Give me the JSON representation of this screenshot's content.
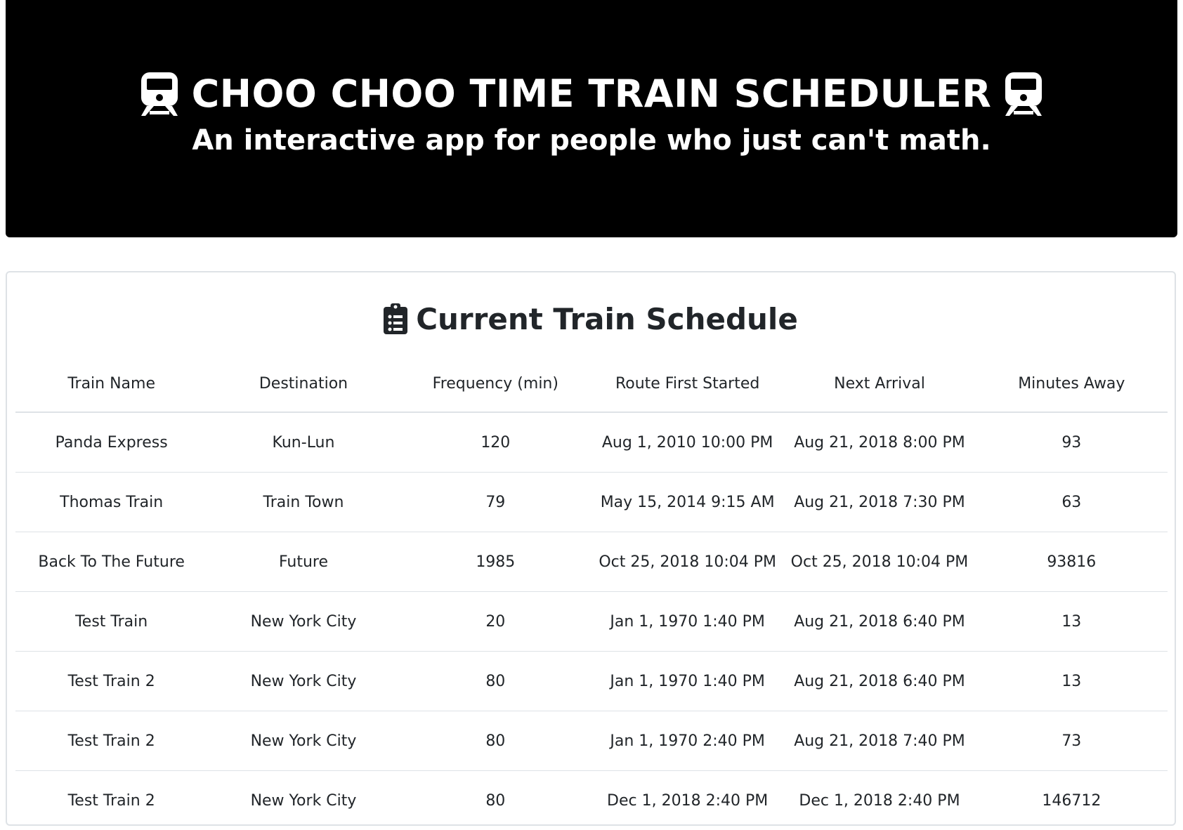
{
  "header": {
    "title": "CHOO CHOO TIME TRAIN SCHEDULER",
    "subtitle": "An interactive app for people who just can't math.",
    "left_icon": "train-icon",
    "right_icon": "train-icon"
  },
  "schedule": {
    "title": "Current Train Schedule",
    "title_icon": "clipboard-list-icon",
    "columns": [
      "Train Name",
      "Destination",
      "Frequency (min)",
      "Route First Started",
      "Next Arrival",
      "Minutes Away"
    ],
    "rows": [
      [
        "Panda Express",
        "Kun-Lun",
        "120",
        "Aug 1, 2010 10:00 PM",
        "Aug 21, 2018 8:00 PM",
        "93"
      ],
      [
        "Thomas Train",
        "Train Town",
        "79",
        "May 15, 2014 9:15 AM",
        "Aug 21, 2018 7:30 PM",
        "63"
      ],
      [
        "Back To The Future",
        "Future",
        "1985",
        "Oct 25, 2018 10:04 PM",
        "Oct 25, 2018 10:04 PM",
        "93816"
      ],
      [
        "Test Train",
        "New York City",
        "20",
        "Jan 1, 1970 1:40 PM",
        "Aug 21, 2018 6:40 PM",
        "13"
      ],
      [
        "Test Train 2",
        "New York City",
        "80",
        "Jan 1, 1970 1:40 PM",
        "Aug 21, 2018 6:40 PM",
        "13"
      ],
      [
        "Test Train 2",
        "New York City",
        "80",
        "Jan 1, 1970 2:40 PM",
        "Aug 21, 2018 7:40 PM",
        "73"
      ],
      [
        "Test Train 2",
        "New York City",
        "80",
        "Dec 1, 2018 2:40 PM",
        "Dec 1, 2018 2:40 PM",
        "146712"
      ]
    ]
  },
  "colors": {
    "hero_background": "#000000",
    "hero_text": "#ffffff",
    "text": "#212529",
    "border": "#dee2e6"
  }
}
